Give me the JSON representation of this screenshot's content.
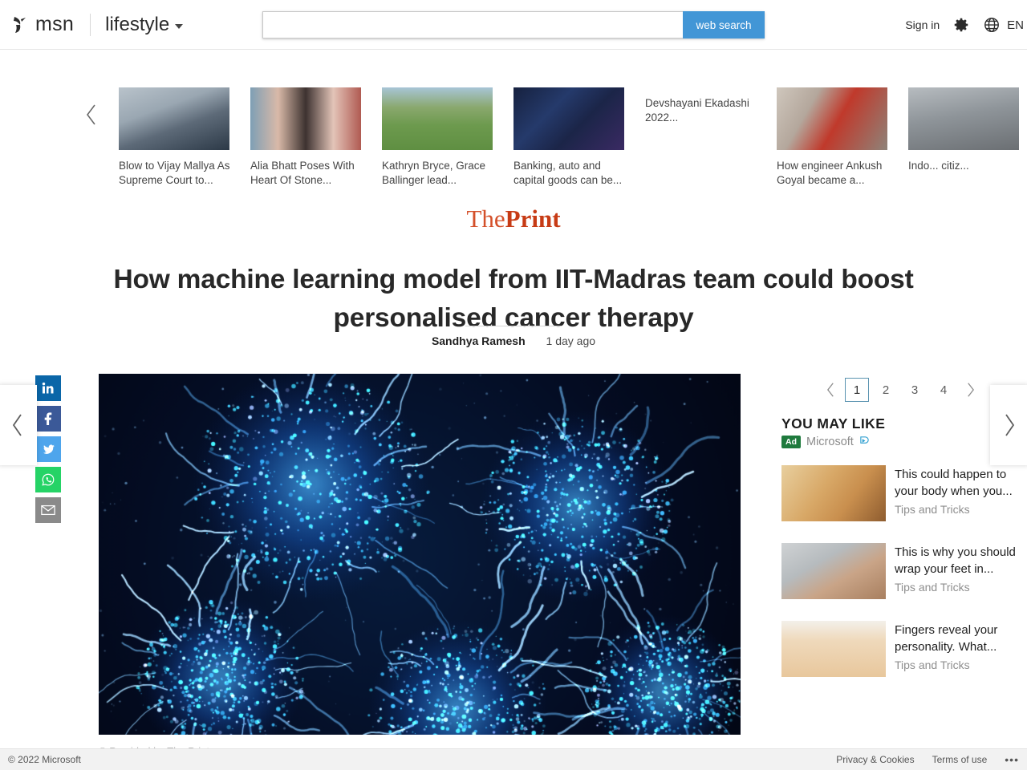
{
  "header": {
    "logo_word": "msn",
    "logo_icon": "msn-butterfly-icon",
    "vertical": "lifestyle",
    "search": {
      "value": "",
      "placeholder": "",
      "button_label": "web search"
    },
    "sign_in": "Sign in",
    "settings_icon": "gear-icon",
    "globe_icon": "globe-icon",
    "language": "EN"
  },
  "carousel": {
    "prev_icon": "chevron-left-icon",
    "next_icon": "chevron-right-icon",
    "items": [
      {
        "title": "Blow to Vijay Mallya As Supreme Court to...",
        "has_image": true,
        "theme": "portrait-suit"
      },
      {
        "title": "Alia Bhatt Poses With Heart Of Stone...",
        "has_image": true,
        "theme": "celebrity-group"
      },
      {
        "title": "Kathryn Bryce, Grace Ballinger lead...",
        "has_image": true,
        "theme": "cricket-field"
      },
      {
        "title": "Banking, auto and capital goods can be...",
        "has_image": true,
        "theme": "trading-screens"
      },
      {
        "title": "Devshayani Ekadashi 2022...",
        "has_image": false,
        "theme": "none"
      },
      {
        "title": "How engineer Ankush Goyal became a...",
        "has_image": true,
        "theme": "man-red-jacket"
      },
      {
        "title": "Indo... citiz...",
        "has_image": true,
        "theme": "street-scene"
      }
    ]
  },
  "article": {
    "publisher_part1": "The",
    "publisher_part2": "Print",
    "headline": "How machine learning model from IIT-Madras team could boost personalised cancer therapy",
    "author": "Sandhya Ramesh",
    "timestamp": "1 day ago",
    "image_credit": "© Provided by The Print",
    "image_alt": "fluorescent-microscopy-cancer-cells"
  },
  "share": {
    "items": [
      {
        "name": "linkedin-share-button",
        "glyph": "in",
        "color": "#0a66a8"
      },
      {
        "name": "facebook-share-button",
        "glyph": "f",
        "color": "#3b5998"
      },
      {
        "name": "twitter-share-button",
        "glyph": "bird",
        "color": "#4ea5ec"
      },
      {
        "name": "whatsapp-share-button",
        "glyph": "phone",
        "color": "#25d366"
      },
      {
        "name": "email-share-button",
        "glyph": "envelope",
        "color": "#8a8a8a"
      }
    ]
  },
  "page_nav": {
    "prev_icon": "chevron-left-icon",
    "next_icon": "chevron-right-icon"
  },
  "pagination": {
    "prev_icon": "chevron-left-icon",
    "next_icon": "chevron-right-icon",
    "pages": [
      "1",
      "2",
      "3",
      "4"
    ],
    "active": "1"
  },
  "sidebar": {
    "section_title": "YOU MAY LIKE",
    "ad_badge": "Ad",
    "ad_source": "Microsoft",
    "adchoices_icon": "adchoices-icon",
    "ads": [
      {
        "headline": "This could happen to your body when you...",
        "source": "Tips and Tricks",
        "theme": "ginger"
      },
      {
        "headline": "This is why you should wrap your feet in...",
        "source": "Tips and Tricks",
        "theme": "foil-foot"
      },
      {
        "headline": "Fingers reveal your personality. What...",
        "source": "Tips and Tricks",
        "theme": "hands"
      }
    ]
  },
  "footer": {
    "copyright": "© 2022 Microsoft",
    "privacy": "Privacy & Cookies",
    "terms": "Terms of use",
    "more": "•••"
  }
}
